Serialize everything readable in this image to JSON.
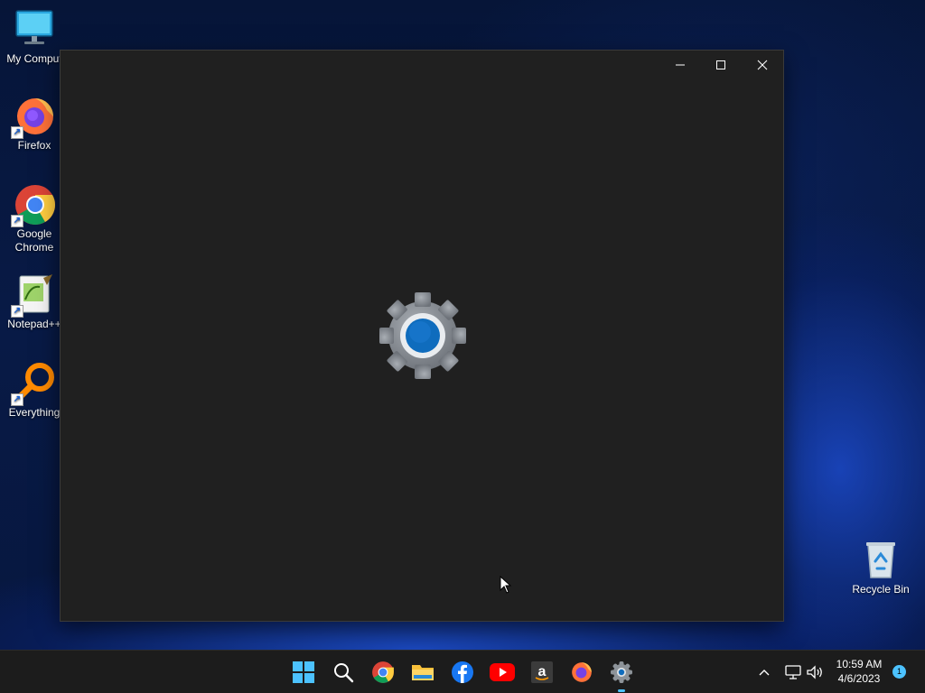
{
  "desktop": {
    "icons": [
      {
        "label": "My Comput",
        "icon": "monitor-icon"
      },
      {
        "label": "Firefox",
        "icon": "firefox-icon"
      },
      {
        "label": "Google\nChrome",
        "icon": "chrome-icon"
      },
      {
        "label": "Notepad++",
        "icon": "notepadpp-icon"
      },
      {
        "label": "Everything",
        "icon": "everything-icon"
      },
      {
        "label": "Recycle Bin",
        "icon": "recycle-bin-icon"
      }
    ]
  },
  "window": {
    "app_icon": "settings-gear-icon",
    "controls": {
      "minimize": "minimize-icon",
      "maximize": "maximize-icon",
      "close": "close-icon"
    }
  },
  "taskbar": {
    "apps": [
      "start-icon",
      "search-icon",
      "chrome-icon",
      "file-explorer-icon",
      "facebook-icon",
      "youtube-icon",
      "amazon-icon",
      "firefox-icon",
      "settings-icon"
    ],
    "active_app": "settings-icon",
    "clock": {
      "time": "10:59 AM",
      "date": "4/6/2023"
    },
    "notification_count": "1"
  },
  "colors": {
    "window_bg": "#202020",
    "taskbar_bg": "#1c1c1c",
    "accent": "#0f6cbd",
    "desktop_bg": "#081a46"
  }
}
